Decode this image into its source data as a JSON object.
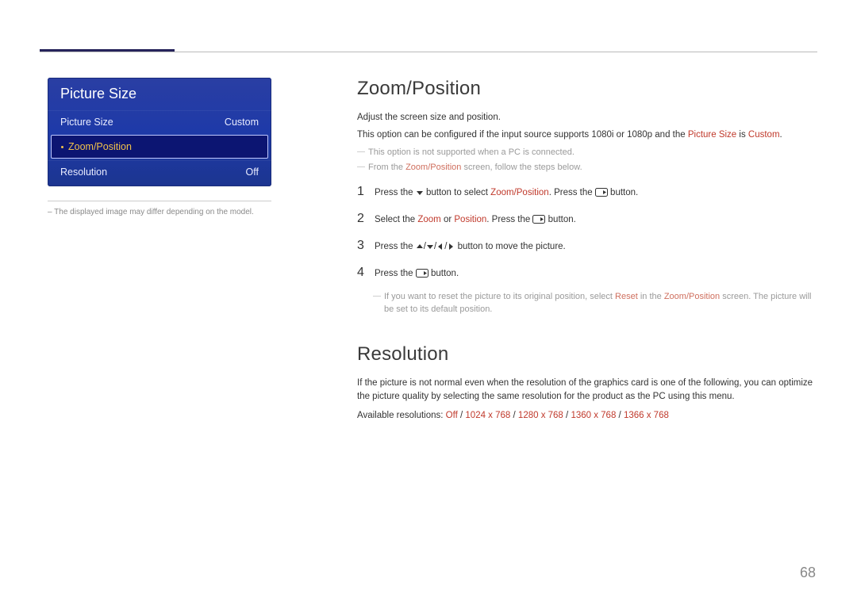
{
  "page_number": "68",
  "menu": {
    "title": "Picture Size",
    "rows": [
      {
        "label": "Picture Size",
        "value": "Custom",
        "selected": false
      },
      {
        "label": "Zoom/Position",
        "value": "",
        "selected": true
      },
      {
        "label": "Resolution",
        "value": "Off",
        "selected": false
      }
    ],
    "disclaimer": "–  The displayed image may differ depending on the model."
  },
  "zoom_position": {
    "heading": "Zoom/Position",
    "intro": "Adjust the screen size and position.",
    "config_prefix": "This option can be configured if the input source supports 1080i or 1080p and the ",
    "config_hl1": "Picture Size",
    "config_mid": " is ",
    "config_hl2": "Custom",
    "config_suffix": ".",
    "note1": "This option is not supported when a PC is connected.",
    "note2_prefix": "From the ",
    "note2_hl": "Zoom/Position",
    "note2_suffix": " screen, follow the steps below.",
    "steps": {
      "s1_a": "Press the ",
      "s1_b": " button to select ",
      "s1_hl": "Zoom/Position",
      "s1_c": ". Press the ",
      "s1_d": " button.",
      "s2_a": "Select the ",
      "s2_hl1": "Zoom",
      "s2_b": " or ",
      "s2_hl2": "Position",
      "s2_c": ". Press the ",
      "s2_d": " button.",
      "s3_a": "Press the ",
      "s3_b": " button to move the picture.",
      "s4_a": "Press the ",
      "s4_b": " button."
    },
    "reset_note_a": "If you want to reset the picture to its original position, select ",
    "reset_note_hl1": "Reset",
    "reset_note_b": " in the ",
    "reset_note_hl2": "Zoom/Position",
    "reset_note_c": " screen. The picture will be set to its default position."
  },
  "resolution": {
    "heading": "Resolution",
    "body": "If the picture is not normal even when the resolution of the graphics card is one of the following, you can optimize the picture quality by selecting the same resolution for the product as the PC using this menu.",
    "avail_label": "Available resolutions: ",
    "opts": [
      "Off",
      "1024 x 768",
      "1280 x 768",
      "1360 x 768",
      "1366 x 768"
    ],
    "sep": " / "
  }
}
